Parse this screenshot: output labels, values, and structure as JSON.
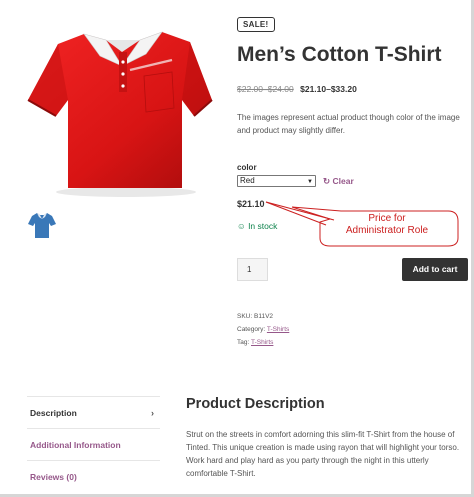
{
  "product": {
    "sale_badge": "SALE!",
    "title": "Men’s Cotton T-Shirt",
    "price_old": "$22.00–$24.00",
    "price_new": "$21.10–$33.20",
    "description": "The images represent actual product though color of the image and product may slightly differ."
  },
  "variation": {
    "label": "color",
    "selected": "Red",
    "clear_label": "Clear",
    "price": "$21.10",
    "stock": "In stock"
  },
  "annotation": {
    "line1": "Price for",
    "line2": "Administrator Role",
    "color": "#cc2020"
  },
  "cart": {
    "quantity": "1",
    "add_label": "Add to cart"
  },
  "meta": {
    "sku_label": "SKU:",
    "sku_value": "B11V2",
    "category_label": "Category:",
    "category_value": "T-Shirts",
    "tag_label": "Tag:",
    "tag_value": "T-Shirts"
  },
  "tabs": [
    {
      "label": "Description"
    },
    {
      "label": "Additional Information"
    },
    {
      "label": "Reviews (0)"
    }
  ],
  "product_description": {
    "title": "Product Description",
    "body": "Strut on the streets in comfort adorning this slim-fit T-Shirt from the house of Tinted. This unique creation is made using rayon that will highlight your torso. Work hard and play hard as you party through the night in this utterly comfortable T-Shirt."
  },
  "colors": {
    "accent": "#96588a",
    "stock": "#0f834d",
    "button": "#333333",
    "shirt": "#e01a1a",
    "thumb_shirt": "#3a78b8"
  }
}
